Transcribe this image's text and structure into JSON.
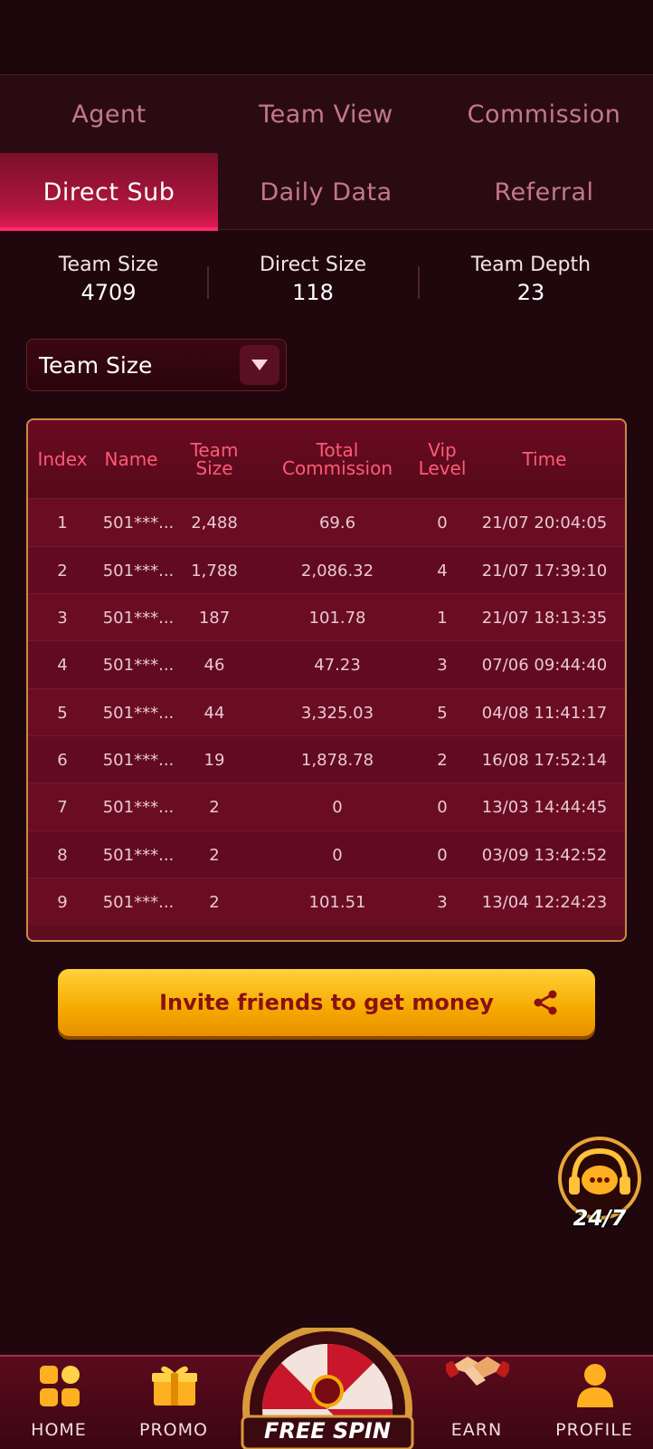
{
  "tabs": [
    {
      "label": "Agent"
    },
    {
      "label": "Team View"
    },
    {
      "label": "Commission"
    },
    {
      "label": "Direct Sub",
      "active": true
    },
    {
      "label": "Daily Data"
    },
    {
      "label": "Referral"
    }
  ],
  "stats": [
    {
      "label": "Team Size",
      "value": "4709"
    },
    {
      "label": "Direct Size",
      "value": "118"
    },
    {
      "label": "Team Depth",
      "value": "23"
    }
  ],
  "filter": {
    "selected": "Team Size"
  },
  "table": {
    "headers": [
      "Index",
      "Name",
      "Team Size",
      "Total Commission",
      "Vip Level",
      "Time"
    ],
    "rows": [
      [
        "1",
        "501***...",
        "2,488",
        "69.6",
        "0",
        "21/07 20:04:05"
      ],
      [
        "2",
        "501***...",
        "1,788",
        "2,086.32",
        "4",
        "21/07 17:39:10"
      ],
      [
        "3",
        "501***...",
        "187",
        "101.78",
        "1",
        "21/07 18:13:35"
      ],
      [
        "4",
        "501***...",
        "46",
        "47.23",
        "3",
        "07/06 09:44:40"
      ],
      [
        "5",
        "501***...",
        "44",
        "3,325.03",
        "5",
        "04/08 11:41:17"
      ],
      [
        "6",
        "501***...",
        "19",
        "1,878.78",
        "2",
        "16/08 17:52:14"
      ],
      [
        "7",
        "501***...",
        "2",
        "0",
        "0",
        "13/03 14:44:45"
      ],
      [
        "8",
        "501***...",
        "2",
        "0",
        "0",
        "03/09 13:42:52"
      ],
      [
        "9",
        "501***...",
        "2",
        "101.51",
        "3",
        "13/04 12:24:23"
      ]
    ]
  },
  "invite": {
    "label": "Invite friends to get money"
  },
  "support": {
    "label": "24/7"
  },
  "nav": [
    {
      "label": "HOME",
      "icon": "home-icon"
    },
    {
      "label": "PROMO",
      "icon": "gift-icon"
    },
    {
      "label": "FREE SPIN",
      "icon": "spin-wheel-icon"
    },
    {
      "label": "EARN",
      "icon": "handshake-icon"
    },
    {
      "label": "PROFILE",
      "icon": "user-icon"
    }
  ],
  "colors": {
    "accent": "#e8195a",
    "gold": "#f5a900",
    "header_text": "#ff5a7a"
  }
}
